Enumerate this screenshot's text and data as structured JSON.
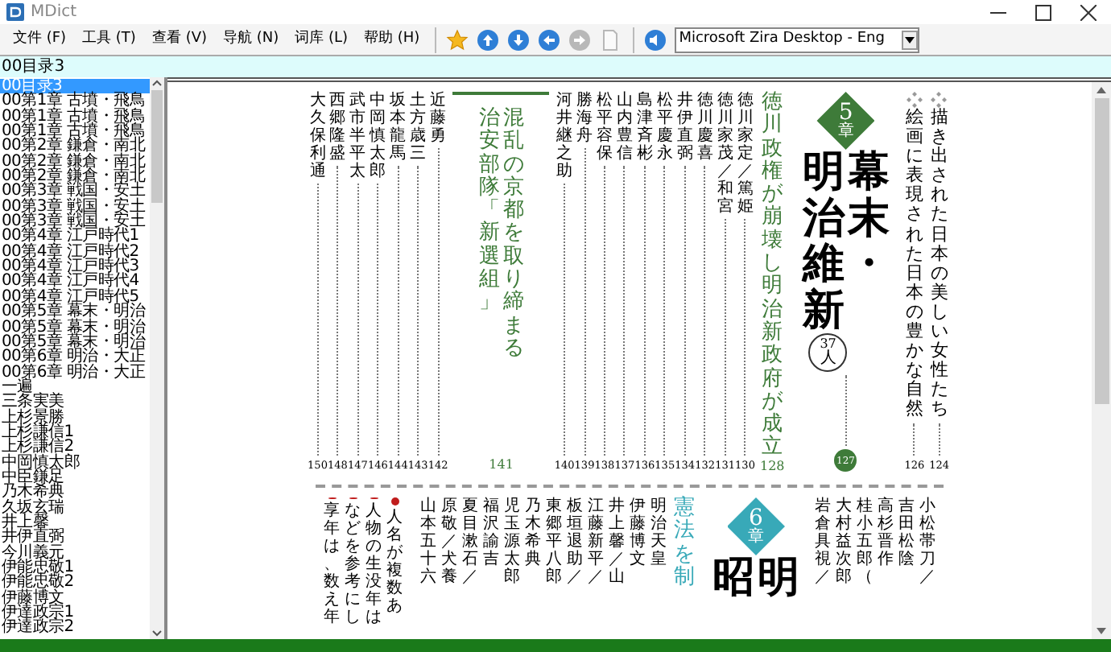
{
  "window": {
    "title": "MDict"
  },
  "menu": [
    "文件 (F)",
    "工具 (T)",
    "查看 (V)",
    "导航 (N)",
    "词库 (L)",
    "帮助 (H)"
  ],
  "toolbar": {
    "buttons": [
      {
        "kind": "star",
        "disabled": false
      },
      {
        "kind": "up",
        "disabled": false
      },
      {
        "kind": "down",
        "disabled": false
      },
      {
        "kind": "back",
        "disabled": false
      },
      {
        "kind": "forward",
        "disabled": true
      },
      {
        "kind": "page",
        "disabled": true
      },
      {
        "kind": "speak",
        "disabled": false
      }
    ],
    "voice": "Microsoft Zira Desktop - Eng"
  },
  "search": {
    "value": "00目录3"
  },
  "sidebar": {
    "items": [
      {
        "label": "00目录3",
        "selected": true
      },
      {
        "label": "00第1章 古墳・飛鳥",
        "selected": false
      },
      {
        "label": "00第1章 古墳・飛鳥",
        "selected": false
      },
      {
        "label": "00第1章 古墳・飛鳥",
        "selected": false
      },
      {
        "label": "00第2章 鎌倉・南北",
        "selected": false
      },
      {
        "label": "00第2章 鎌倉・南北",
        "selected": false
      },
      {
        "label": "00第2章 鎌倉・南北",
        "selected": false
      },
      {
        "label": "00第3章 戦国・安土",
        "selected": false
      },
      {
        "label": "00第3章 戦国・安土",
        "selected": false
      },
      {
        "label": "00第3章 戦国・安土",
        "selected": false
      },
      {
        "label": "00第4章 江戸時代1",
        "selected": false
      },
      {
        "label": "00第4章 江戸時代2",
        "selected": false
      },
      {
        "label": "00第4章 江戸時代3",
        "selected": false
      },
      {
        "label": "00第4章 江戸時代4",
        "selected": false
      },
      {
        "label": "00第4章 江戸時代5",
        "selected": false
      },
      {
        "label": "00第5章 幕末・明治",
        "selected": false
      },
      {
        "label": "00第5章 幕末・明治",
        "selected": false
      },
      {
        "label": "00第5章 幕末・明治",
        "selected": false
      },
      {
        "label": "00第6章 明治・大正",
        "selected": false
      },
      {
        "label": "00第6章 明治・大正",
        "selected": false
      },
      {
        "label": "一遍",
        "selected": false
      },
      {
        "label": "三条実美",
        "selected": false
      },
      {
        "label": "上杉景勝",
        "selected": false
      },
      {
        "label": "上杉謙信1",
        "selected": false
      },
      {
        "label": "上杉謙信2",
        "selected": false
      },
      {
        "label": "中岡慎太郎",
        "selected": false
      },
      {
        "label": "中臣鎌足",
        "selected": false
      },
      {
        "label": "乃木希典",
        "selected": false
      },
      {
        "label": "久坂玄瑞",
        "selected": false
      },
      {
        "label": "井上馨",
        "selected": false
      },
      {
        "label": "井伊直弼",
        "selected": false
      },
      {
        "label": "今川義元",
        "selected": false
      },
      {
        "label": "伊能忠敬1",
        "selected": false
      },
      {
        "label": "伊能忠敬2",
        "selected": false
      },
      {
        "label": "伊藤博文",
        "selected": false
      },
      {
        "label": "伊達政宗1",
        "selected": false
      },
      {
        "label": "伊達政宗2",
        "selected": false
      }
    ]
  },
  "page": {
    "top": [
      {
        "kind": "person",
        "text": "大久保利通",
        "page": "150"
      },
      {
        "kind": "person",
        "text": "西郷隆盛",
        "page": "148"
      },
      {
        "kind": "person",
        "text": "武市半平太",
        "page": "147"
      },
      {
        "kind": "person",
        "text": "中岡慎太郎",
        "page": "146"
      },
      {
        "kind": "person",
        "text": "坂本龍馬",
        "page": "144"
      },
      {
        "kind": "person",
        "text": "土方歳三",
        "page": "143"
      },
      {
        "kind": "person",
        "text": "近藤勇",
        "page": "142"
      },
      {
        "kind": "heading",
        "text": [
          "治安部隊「新選組」",
          "混乱の京都を取り締まる"
        ],
        "page": "141",
        "rule": true,
        "color": "#3e7b39"
      },
      {
        "kind": "person",
        "text": "河井継之助",
        "page": "140"
      },
      {
        "kind": "person",
        "text": "勝海舟",
        "page": "139"
      },
      {
        "kind": "person",
        "text": "松平容保",
        "page": "138"
      },
      {
        "kind": "person",
        "text": "山内豊信",
        "page": "137"
      },
      {
        "kind": "person",
        "text": "島津斉彬",
        "page": "136"
      },
      {
        "kind": "person",
        "text": "松平慶永",
        "page": "135"
      },
      {
        "kind": "person",
        "text": "井伊直弼",
        "page": "134"
      },
      {
        "kind": "person",
        "text": "徳川慶喜",
        "page": "132"
      },
      {
        "kind": "person",
        "text": "徳川家茂／和宮",
        "page": "131"
      },
      {
        "kind": "person",
        "text": "徳川家定／篤姫",
        "page": "130"
      },
      {
        "kind": "heading",
        "text": [
          "徳川政権が崩壊し明治新政府が成立"
        ],
        "page": "128",
        "color": "#3e7b39"
      },
      {
        "kind": "chapter",
        "number": "5",
        "unit": "章",
        "title": [
          "明治維新",
          "幕末・"
        ],
        "count": "37",
        "count_unit": "人",
        "page": "127",
        "color": "#3e7b39"
      },
      {
        "kind": "essay",
        "text": "絵画に表現された日本の豊かな自然",
        "page": "126"
      },
      {
        "kind": "essay",
        "text": "描き出された日本の美しい女性たち",
        "page": "124"
      }
    ],
    "bottom": [
      {
        "kind": "note",
        "text": "享年は、数え年"
      },
      {
        "kind": "note",
        "text": "などを参考にし"
      },
      {
        "kind": "note",
        "text": "人物の生没年は"
      },
      {
        "kind": "note",
        "text": "人名が複数あ"
      },
      {
        "kind": "person",
        "text": "山本五十六"
      },
      {
        "kind": "person",
        "text": "原敬／犬養"
      },
      {
        "kind": "person",
        "text": "夏目漱石／"
      },
      {
        "kind": "person",
        "text": "福沢諭吉"
      },
      {
        "kind": "person",
        "text": "児玉源太郎"
      },
      {
        "kind": "person",
        "text": "乃木希典"
      },
      {
        "kind": "person",
        "text": "東郷平八郎"
      },
      {
        "kind": "person",
        "text": "板垣退助／"
      },
      {
        "kind": "person",
        "text": "江藤新平／"
      },
      {
        "kind": "person",
        "text": "井上馨／山"
      },
      {
        "kind": "person",
        "text": "伊藤博文"
      },
      {
        "kind": "person",
        "text": "明治天皇"
      },
      {
        "kind": "heading",
        "text": [
          "憲法を制"
        ],
        "color": "#38a9b8"
      },
      {
        "kind": "chapter",
        "number": "6",
        "unit": "章",
        "title": [
          "昭",
          "明"
        ],
        "color": "#38a9b8"
      },
      {
        "kind": "person",
        "text": "岩倉具視／"
      },
      {
        "kind": "person",
        "text": "大村益次郎"
      },
      {
        "kind": "person",
        "text": "桂小五郎（"
      },
      {
        "kind": "person",
        "text": "高杉晋作"
      },
      {
        "kind": "person",
        "text": "吉田松陰"
      },
      {
        "kind": "person",
        "text": "小松帯刀／"
      }
    ]
  }
}
